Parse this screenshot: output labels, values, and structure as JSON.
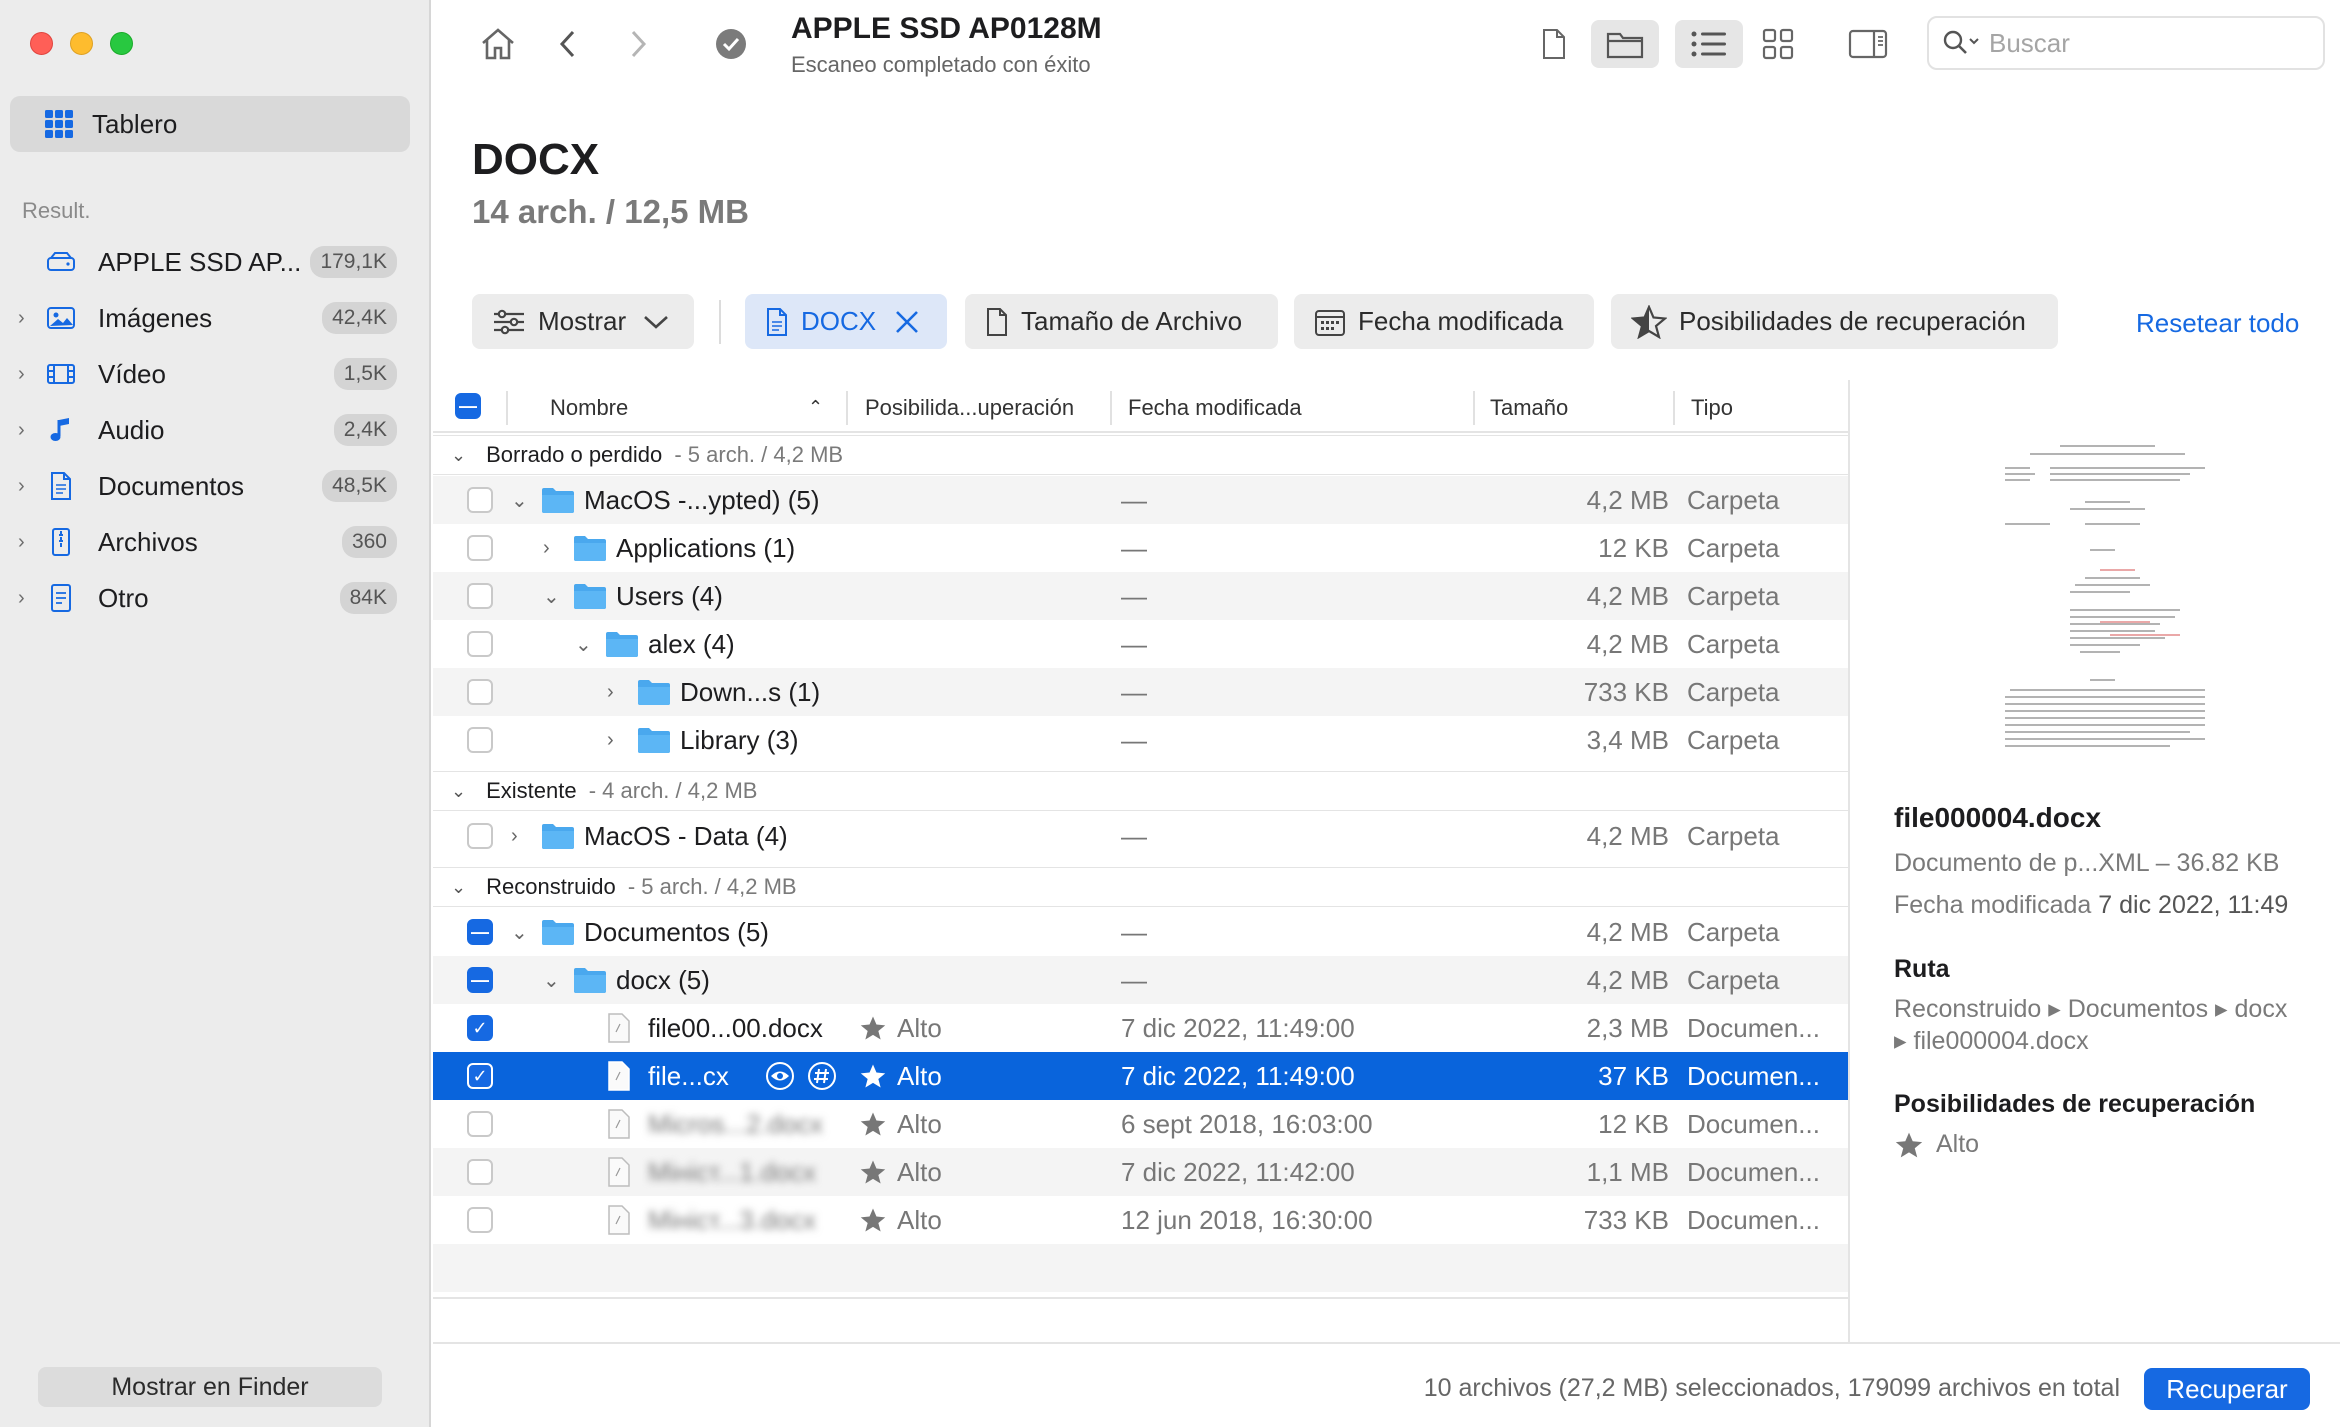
{
  "sidebar": {
    "dashboard_label": "Tablero",
    "section_label": "Result.",
    "items": [
      {
        "label": "APPLE SSD AP...",
        "count": "179,1K",
        "icon": "drive-icon"
      },
      {
        "label": "Imágenes",
        "count": "42,4K",
        "icon": "image-icon"
      },
      {
        "label": "Vídeo",
        "count": "1,5K",
        "icon": "film-icon"
      },
      {
        "label": "Audio",
        "count": "2,4K",
        "icon": "music-note-icon"
      },
      {
        "label": "Documentos",
        "count": "48,5K",
        "icon": "document-icon"
      },
      {
        "label": "Archivos",
        "count": "360",
        "icon": "archive-icon"
      },
      {
        "label": "Otro",
        "count": "84K",
        "icon": "other-file-icon"
      }
    ],
    "finder_button": "Mostrar en Finder"
  },
  "toolbar": {
    "title": "APPLE SSD AP0128M",
    "subtitle": "Escaneo completado con éxito",
    "search_placeholder": "Buscar"
  },
  "header": {
    "title": "DOCX",
    "subtitle": "14 arch. / 12,5 MB"
  },
  "filters": {
    "show": "Mostrar",
    "docx": "DOCX",
    "size": "Tamaño de Archivo",
    "date": "Fecha modificada",
    "chances": "Posibilidades de recuperación",
    "reset": "Resetear todo"
  },
  "table": {
    "columns": {
      "name": "Nombre",
      "chances": "Posibilida...uperación",
      "date": "Fecha modificada",
      "size": "Tamaño",
      "type": "Tipo"
    },
    "groups": [
      {
        "label": "Borrado o perdido",
        "count": "5 arch. / 4,2 MB"
      },
      {
        "label": "Existente",
        "count": "4 arch. / 4,2 MB"
      },
      {
        "label": "Reconstruido",
        "count": "5 arch. / 4,2 MB"
      }
    ],
    "rows": [
      {
        "name": "MacOS -...ypted) (5)",
        "date": "—",
        "size": "4,2 MB",
        "type": "Carpeta"
      },
      {
        "name": "Applications (1)",
        "date": "—",
        "size": "12 KB",
        "type": "Carpeta"
      },
      {
        "name": "Users (4)",
        "date": "—",
        "size": "4,2 MB",
        "type": "Carpeta"
      },
      {
        "name": "alex (4)",
        "date": "—",
        "size": "4,2 MB",
        "type": "Carpeta"
      },
      {
        "name": "Down...s (1)",
        "date": "—",
        "size": "733 KB",
        "type": "Carpeta"
      },
      {
        "name": "Library (3)",
        "date": "—",
        "size": "3,4 MB",
        "type": "Carpeta"
      },
      {
        "name": "MacOS - Data (4)",
        "date": "—",
        "size": "4,2 MB",
        "type": "Carpeta"
      },
      {
        "name": "Documentos (5)",
        "date": "—",
        "size": "4,2 MB",
        "type": "Carpeta"
      },
      {
        "name": "docx (5)",
        "date": "—",
        "size": "4,2 MB",
        "type": "Carpeta"
      },
      {
        "name": "file00...00.docx",
        "chance": "Alto",
        "date": "7 dic 2022, 11:49:00",
        "size": "2,3 MB",
        "type": "Documen..."
      },
      {
        "name": "file...cx",
        "chance": "Alto",
        "date": "7 dic 2022, 11:49:00",
        "size": "37 KB",
        "type": "Documen..."
      },
      {
        "name": "Micros...2.docx",
        "chance": "Alto",
        "date": "6 sept 2018, 16:03:00",
        "size": "12 KB",
        "type": "Documen..."
      },
      {
        "name": "Мініст...1.docx",
        "chance": "Alto",
        "date": "7 dic 2022, 11:42:00",
        "size": "1,1 MB",
        "type": "Documen..."
      },
      {
        "name": "Мініст...3.docx",
        "chance": "Alto",
        "date": "12 jun 2018, 16:30:00",
        "size": "733 KB",
        "type": "Documen..."
      }
    ]
  },
  "preview": {
    "filename": "file000004.docx",
    "kind": "Documento de p...XML – 36.82 KB",
    "modified_label": "Fecha modificada",
    "modified_value": "7 dic 2022, 11:49",
    "path_label": "Ruta",
    "path_line1": "Reconstruido ▸ Documentos ▸ docx",
    "path_line2": "▸ file000004.docx",
    "chances_label": "Posibilidades de recuperación",
    "chances_value": "Alto"
  },
  "footer": {
    "status": "10 archivos (27,2 MB) seleccionados, 179099 archivos en total",
    "recover": "Recuperar"
  },
  "colors": {
    "accent": "#1669e2",
    "selection": "#0964dc",
    "folder": "#4aa8ee"
  }
}
